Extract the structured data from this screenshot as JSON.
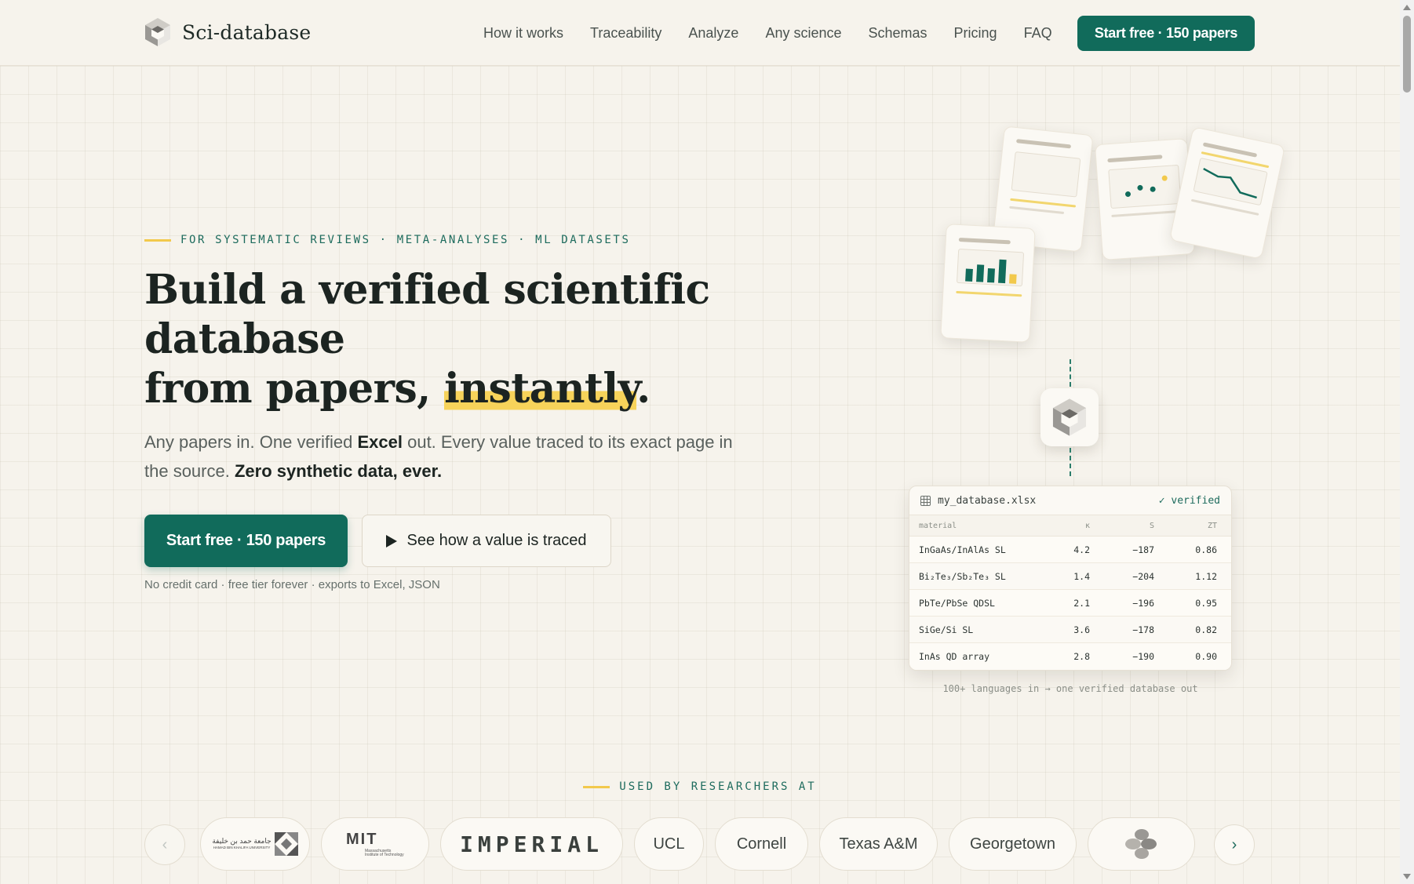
{
  "brand": {
    "name": "Sci-database"
  },
  "nav": {
    "items": [
      "How it works",
      "Traceability",
      "Analyze",
      "Any science",
      "Schemas",
      "Pricing",
      "FAQ"
    ],
    "cta": "Start free · 150 papers"
  },
  "hero": {
    "eyebrow": "FOR SYSTEMATIC REVIEWS · META-ANALYSES · ML DATASETS",
    "headline_line1": "Build a verified scientific database",
    "headline_line2_pre": "from papers, ",
    "headline_highlight": "instantly",
    "headline_end": ".",
    "sub_1": "Any papers in. One verified ",
    "sub_bold_1": "Excel",
    "sub_2": " out. Every value traced to its exact page in the source. ",
    "sub_bold_2": "Zero synthetic data, ever.",
    "cta_primary": "Start free · 150 papers",
    "cta_secondary": "See how a value is traced",
    "fineprint": "No credit card · free tier forever · exports to Excel, JSON"
  },
  "table_card": {
    "filename": "my_database.xlsx",
    "status": "✓ verified",
    "columns": [
      "material",
      "κ",
      "S",
      "ZT"
    ],
    "rows": [
      [
        "InGaAs/InAlAs SL",
        "4.2",
        "−187",
        "0.86"
      ],
      [
        "Bi₂Te₃/Sb₂Te₃ SL",
        "1.4",
        "−204",
        "1.12"
      ],
      [
        "PbTe/PbSe QDSL",
        "2.1",
        "−196",
        "0.95"
      ],
      [
        "SiGe/Si SL",
        "3.6",
        "−178",
        "0.82"
      ],
      [
        "InAs QD array",
        "2.8",
        "−190",
        "0.90"
      ]
    ],
    "caption": "100+ languages in → one verified database out"
  },
  "logos": {
    "label": "USED BY RESEARCHERS AT",
    "items": [
      "Hamad Bin Khalifa University",
      "Massachusetts Institute of Technology",
      "IMPERIAL",
      "UCL",
      "Cornell",
      "Texas A&M",
      "Georgetown",
      ""
    ],
    "hbku_arabic": "جامعة حمد بن خليفة",
    "hbku_en": "HAMAD BIN KHALIFA UNIVERSITY",
    "mit_mark": "MIT",
    "mit_text": "Massachusetts Institute of Technology",
    "prev": "‹",
    "next": "›"
  },
  "colors": {
    "accent": "#116b5b",
    "highlight": "#f7d35a",
    "background": "#f6f3ec"
  }
}
